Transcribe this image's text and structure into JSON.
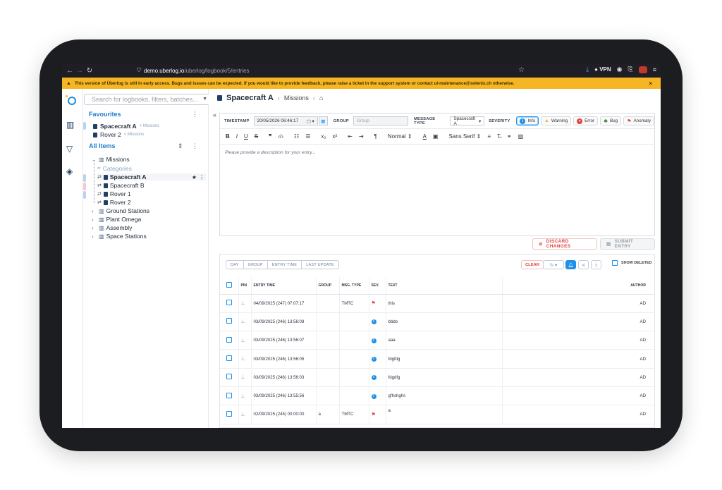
{
  "browser": {
    "url_host": "demo.uberlog.io",
    "url_path": "/uberlog/logbook/5/entries",
    "vpn_label": "VPN"
  },
  "banner": {
    "text": "This version of Überlog is still in early access. Bugs and issues can be expected. If you would like to provide feedback, please raise a ticket in the support system or contact ul-maintenance@solenix.ch otherwise.",
    "close": "×"
  },
  "sidebar": {
    "search_placeholder": "Search for logbooks, filters, batches...",
    "favourites_title": "Favourites",
    "favourites": [
      {
        "name": "Spacecraft A",
        "parent": "< Missions"
      },
      {
        "name": "Rover 2",
        "parent": "< Missions"
      }
    ],
    "all_items_title": "All Items",
    "tree": {
      "missions": "Missions",
      "categories": "Categories",
      "children": [
        "Spacecraft A",
        "Spacecraft B",
        "Rover 1",
        "Rover 2"
      ],
      "folders": [
        "Ground Stations",
        "Plant Omega",
        "Assembly",
        "Space Stations"
      ]
    }
  },
  "header": {
    "title": "Spacecraft A",
    "parent": "Missions"
  },
  "editor": {
    "timestamp_label": "TIMESTAMP",
    "timestamp_value": "20/05/2026 06:46:17",
    "group_label": "GROUP",
    "group_placeholder": "Group",
    "msgtype_label": "MESSAGE TYPE",
    "msgtype_value": "Spacecraft A",
    "severity_label": "SEVERITY",
    "severities": [
      {
        "label": "Info",
        "color": "#1e90e8",
        "glyph": "i"
      },
      {
        "label": "Warning",
        "color": "#f6b623",
        "glyph": "!"
      },
      {
        "label": "Error",
        "color": "#e0423d",
        "glyph": "×"
      },
      {
        "label": "Bug",
        "color": "#2e7d32",
        "glyph": "✱"
      },
      {
        "label": "Anomaly",
        "color": "#e0423d",
        "glyph": "⚑"
      }
    ],
    "toolbar": {
      "size": "Normal",
      "font": "Sans Serif"
    },
    "placeholder": "Please provide a description for your entry..."
  },
  "actions": {
    "discard": "DISCARD CHANGES",
    "submit": "SUBMIT ENTRY"
  },
  "filters": {
    "tabs": [
      "DAY",
      "GROUP",
      "ENTRY TIME",
      "LAST UPDATE"
    ],
    "clear": "CLEAR",
    "show_deleted": "SHOW DELETED"
  },
  "table": {
    "headers": [
      "PIN",
      "ENTRY TIME",
      "GROUP",
      "MSG. TYPE",
      "SEV.",
      "TEXT",
      "AUTHOR"
    ],
    "rows": [
      {
        "time": "04/09/2025 (247) 07:07:17",
        "group": "",
        "type": "TMTC",
        "sev": "anomaly",
        "text": "this",
        "author": "AD"
      },
      {
        "time": "03/09/2025 (246) 13:56:08",
        "group": "",
        "type": "",
        "sev": "info",
        "text": "bbbb",
        "author": "AD"
      },
      {
        "time": "03/09/2025 (246) 13:56:07",
        "group": "",
        "type": "",
        "sev": "info",
        "text": "aaa",
        "author": "AD"
      },
      {
        "time": "03/09/2025 (246) 13:56:05",
        "group": "",
        "type": "",
        "sev": "info",
        "text": "fdgfdg",
        "author": "AD"
      },
      {
        "time": "03/09/2025 (246) 13:56:03",
        "group": "",
        "type": "",
        "sev": "info",
        "text": "fdgdfg",
        "author": "AD"
      },
      {
        "time": "03/09/2025 (246) 13:55:56",
        "group": "",
        "type": "",
        "sev": "info",
        "text": "gfhshghs",
        "author": "AD"
      },
      {
        "time": "02/09/2025 (245) 00:00:00",
        "group": "a",
        "type": "TMTC",
        "sev": "anomaly",
        "text": "a",
        "author": "AD"
      }
    ]
  }
}
